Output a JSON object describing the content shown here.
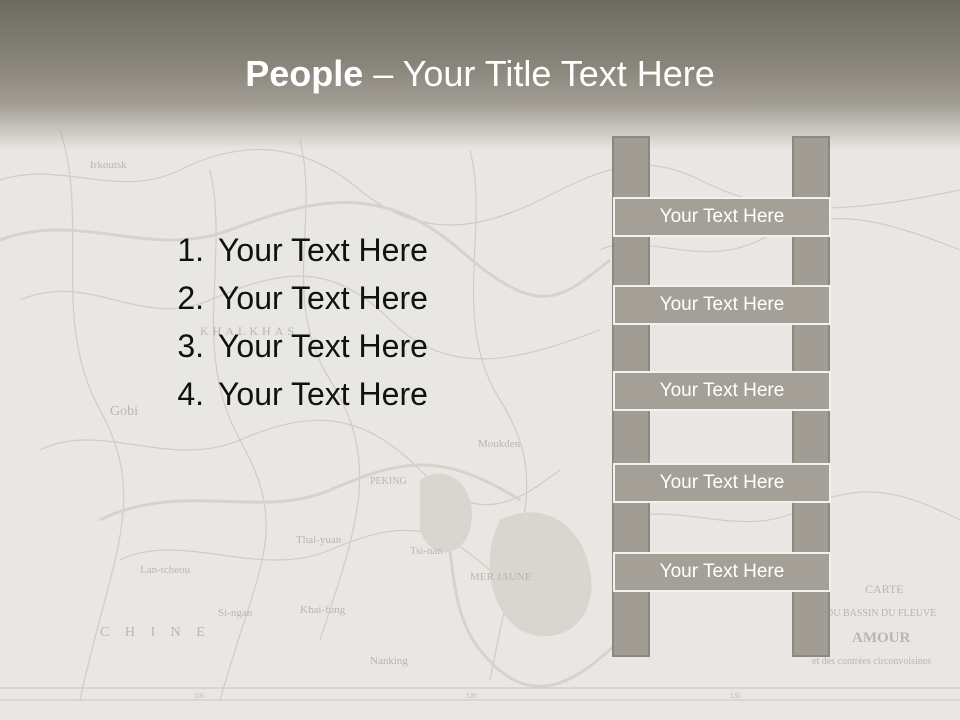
{
  "slide": {
    "title_bold": "People",
    "title_rest": " – Your Title Text Here",
    "list": [
      {
        "number": "1.",
        "text": "Your Text Here"
      },
      {
        "number": "2.",
        "text": "Your Text Here"
      },
      {
        "number": "3.",
        "text": "Your Text Here"
      },
      {
        "number": "4.",
        "text": "Your Text Here"
      }
    ],
    "ladder_rungs": [
      "Your Text Here",
      "Your Text Here",
      "Your Text Here",
      "Your Text Here",
      "Your Text Here"
    ],
    "map_labels": {
      "carte": "CARTE",
      "bassin": "DU BASSIN DU FLEUVE",
      "amour": "AMOUR",
      "contrees": "et des contrées circonvoisines",
      "gobi": "Gobi",
      "peking": "PEKING",
      "thai_yuan": "Thai-yuan",
      "tsi_nan": "Tsi-nan",
      "mer_jaune": "MER JAUNE",
      "moukden": "Moukden",
      "lan_tcheou": "Lan-tcheou",
      "si_ngan": "Si-ngan",
      "khai_fung": "Khai-fung",
      "nanking": "Nanking",
      "irkoutsk": "Irkoutsk",
      "khalkhas": "KHALKHAS",
      "chine": "C H I N E",
      "scale_105": "105",
      "scale_120": "120",
      "scale_135": "135"
    },
    "colors": {
      "header_dark": "#6d6a62",
      "ladder_fill": "#a4a097",
      "text_dark": "#111111",
      "text_light": "#ffffff"
    }
  }
}
